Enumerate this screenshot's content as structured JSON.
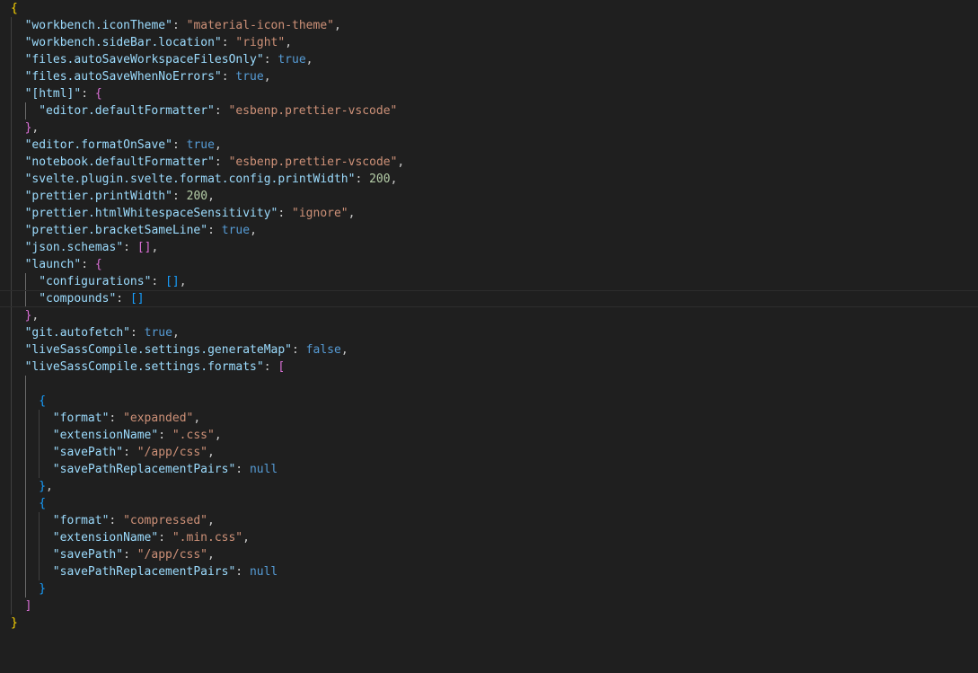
{
  "colors": {
    "background": "#1f1f1f",
    "key": "#9cdcfe",
    "string": "#ce9178",
    "number": "#b5cea8",
    "keyword": "#569cd6",
    "bracket_level_1": "#ffd700",
    "bracket_level_2": "#da70d6",
    "bracket_level_3": "#179fff"
  },
  "lines": [
    {
      "indent": 0,
      "tokens": [
        {
          "t": "{",
          "c": "b1"
        }
      ]
    },
    {
      "indent": 1,
      "tokens": [
        {
          "t": "\"workbench.iconTheme\"",
          "c": "key"
        },
        {
          "t": ": ",
          "c": "punc"
        },
        {
          "t": "\"material-icon-theme\"",
          "c": "str"
        },
        {
          "t": ",",
          "c": "punc"
        }
      ]
    },
    {
      "indent": 1,
      "tokens": [
        {
          "t": "\"workbench.sideBar.location\"",
          "c": "key"
        },
        {
          "t": ": ",
          "c": "punc"
        },
        {
          "t": "\"right\"",
          "c": "str"
        },
        {
          "t": ",",
          "c": "punc"
        }
      ]
    },
    {
      "indent": 1,
      "tokens": [
        {
          "t": "\"files.autoSaveWorkspaceFilesOnly\"",
          "c": "key"
        },
        {
          "t": ": ",
          "c": "punc"
        },
        {
          "t": "true",
          "c": "kw"
        },
        {
          "t": ",",
          "c": "punc"
        }
      ]
    },
    {
      "indent": 1,
      "tokens": [
        {
          "t": "\"files.autoSaveWhenNoErrors\"",
          "c": "key"
        },
        {
          "t": ": ",
          "c": "punc"
        },
        {
          "t": "true",
          "c": "kw"
        },
        {
          "t": ",",
          "c": "punc"
        }
      ]
    },
    {
      "indent": 1,
      "tokens": [
        {
          "t": "\"[html]\"",
          "c": "key"
        },
        {
          "t": ": ",
          "c": "punc"
        },
        {
          "t": "{",
          "c": "b2"
        }
      ]
    },
    {
      "indent": 2,
      "tokens": [
        {
          "t": "\"editor.defaultFormatter\"",
          "c": "key"
        },
        {
          "t": ": ",
          "c": "punc"
        },
        {
          "t": "\"esbenp.prettier-vscode\"",
          "c": "str"
        }
      ]
    },
    {
      "indent": 1,
      "tokens": [
        {
          "t": "}",
          "c": "b2"
        },
        {
          "t": ",",
          "c": "punc"
        }
      ]
    },
    {
      "indent": 1,
      "tokens": [
        {
          "t": "\"editor.formatOnSave\"",
          "c": "key"
        },
        {
          "t": ": ",
          "c": "punc"
        },
        {
          "t": "true",
          "c": "kw"
        },
        {
          "t": ",",
          "c": "punc"
        }
      ]
    },
    {
      "indent": 1,
      "tokens": [
        {
          "t": "\"notebook.defaultFormatter\"",
          "c": "key"
        },
        {
          "t": ": ",
          "c": "punc"
        },
        {
          "t": "\"esbenp.prettier-vscode\"",
          "c": "str"
        },
        {
          "t": ",",
          "c": "punc"
        }
      ]
    },
    {
      "indent": 1,
      "tokens": [
        {
          "t": "\"svelte.plugin.svelte.format.config.printWidth\"",
          "c": "key"
        },
        {
          "t": ": ",
          "c": "punc"
        },
        {
          "t": "200",
          "c": "num"
        },
        {
          "t": ",",
          "c": "punc"
        }
      ]
    },
    {
      "indent": 1,
      "tokens": [
        {
          "t": "\"prettier.printWidth\"",
          "c": "key"
        },
        {
          "t": ": ",
          "c": "punc"
        },
        {
          "t": "200",
          "c": "num"
        },
        {
          "t": ",",
          "c": "punc"
        }
      ]
    },
    {
      "indent": 1,
      "tokens": [
        {
          "t": "\"prettier.htmlWhitespaceSensitivity\"",
          "c": "key"
        },
        {
          "t": ": ",
          "c": "punc"
        },
        {
          "t": "\"ignore\"",
          "c": "str"
        },
        {
          "t": ",",
          "c": "punc"
        }
      ]
    },
    {
      "indent": 1,
      "tokens": [
        {
          "t": "\"prettier.bracketSameLine\"",
          "c": "key"
        },
        {
          "t": ": ",
          "c": "punc"
        },
        {
          "t": "true",
          "c": "kw"
        },
        {
          "t": ",",
          "c": "punc"
        }
      ]
    },
    {
      "indent": 1,
      "tokens": [
        {
          "t": "\"json.schemas\"",
          "c": "key"
        },
        {
          "t": ": ",
          "c": "punc"
        },
        {
          "t": "[]",
          "c": "b2"
        },
        {
          "t": ",",
          "c": "punc"
        }
      ]
    },
    {
      "indent": 1,
      "tokens": [
        {
          "t": "\"launch\"",
          "c": "key"
        },
        {
          "t": ": ",
          "c": "punc"
        },
        {
          "t": "{",
          "c": "b2"
        }
      ]
    },
    {
      "indent": 2,
      "tokens": [
        {
          "t": "\"configurations\"",
          "c": "key"
        },
        {
          "t": ": ",
          "c": "punc"
        },
        {
          "t": "[]",
          "c": "b3"
        },
        {
          "t": ",",
          "c": "punc"
        }
      ]
    },
    {
      "indent": 2,
      "current": true,
      "tokens": [
        {
          "t": "\"compounds\"",
          "c": "key"
        },
        {
          "t": ": ",
          "c": "punc"
        },
        {
          "t": "[]",
          "c": "b3"
        }
      ]
    },
    {
      "indent": 1,
      "tokens": [
        {
          "t": "}",
          "c": "b2"
        },
        {
          "t": ",",
          "c": "punc"
        }
      ]
    },
    {
      "indent": 1,
      "tokens": [
        {
          "t": "\"git.autofetch\"",
          "c": "key"
        },
        {
          "t": ": ",
          "c": "punc"
        },
        {
          "t": "true",
          "c": "kw"
        },
        {
          "t": ",",
          "c": "punc"
        }
      ]
    },
    {
      "indent": 1,
      "tokens": [
        {
          "t": "\"liveSassCompile.settings.generateMap\"",
          "c": "key"
        },
        {
          "t": ": ",
          "c": "punc"
        },
        {
          "t": "false",
          "c": "kw"
        },
        {
          "t": ",",
          "c": "punc"
        }
      ]
    },
    {
      "indent": 1,
      "tokens": [
        {
          "t": "\"liveSassCompile.settings.formats\"",
          "c": "key"
        },
        {
          "t": ": ",
          "c": "punc"
        },
        {
          "t": "[",
          "c": "b2"
        }
      ]
    },
    {
      "indent": 2,
      "tokens": []
    },
    {
      "indent": 2,
      "tokens": [
        {
          "t": "{",
          "c": "b3"
        }
      ]
    },
    {
      "indent": 3,
      "tokens": [
        {
          "t": "\"format\"",
          "c": "key"
        },
        {
          "t": ": ",
          "c": "punc"
        },
        {
          "t": "\"expanded\"",
          "c": "str"
        },
        {
          "t": ",",
          "c": "punc"
        }
      ]
    },
    {
      "indent": 3,
      "tokens": [
        {
          "t": "\"extensionName\"",
          "c": "key"
        },
        {
          "t": ": ",
          "c": "punc"
        },
        {
          "t": "\".css\"",
          "c": "str"
        },
        {
          "t": ",",
          "c": "punc"
        }
      ]
    },
    {
      "indent": 3,
      "tokens": [
        {
          "t": "\"savePath\"",
          "c": "key"
        },
        {
          "t": ": ",
          "c": "punc"
        },
        {
          "t": "\"/app/css\"",
          "c": "str"
        },
        {
          "t": ",",
          "c": "punc"
        }
      ]
    },
    {
      "indent": 3,
      "tokens": [
        {
          "t": "\"savePathReplacementPairs\"",
          "c": "key"
        },
        {
          "t": ": ",
          "c": "punc"
        },
        {
          "t": "null",
          "c": "kw"
        }
      ]
    },
    {
      "indent": 2,
      "tokens": [
        {
          "t": "}",
          "c": "b3"
        },
        {
          "t": ",",
          "c": "punc"
        }
      ]
    },
    {
      "indent": 2,
      "tokens": [
        {
          "t": "{",
          "c": "b3"
        }
      ]
    },
    {
      "indent": 3,
      "tokens": [
        {
          "t": "\"format\"",
          "c": "key"
        },
        {
          "t": ": ",
          "c": "punc"
        },
        {
          "t": "\"compressed\"",
          "c": "str"
        },
        {
          "t": ",",
          "c": "punc"
        }
      ]
    },
    {
      "indent": 3,
      "tokens": [
        {
          "t": "\"extensionName\"",
          "c": "key"
        },
        {
          "t": ": ",
          "c": "punc"
        },
        {
          "t": "\".min.css\"",
          "c": "str"
        },
        {
          "t": ",",
          "c": "punc"
        }
      ]
    },
    {
      "indent": 3,
      "tokens": [
        {
          "t": "\"savePath\"",
          "c": "key"
        },
        {
          "t": ": ",
          "c": "punc"
        },
        {
          "t": "\"/app/css\"",
          "c": "str"
        },
        {
          "t": ",",
          "c": "punc"
        }
      ]
    },
    {
      "indent": 3,
      "tokens": [
        {
          "t": "\"savePathReplacementPairs\"",
          "c": "key"
        },
        {
          "t": ": ",
          "c": "punc"
        },
        {
          "t": "null",
          "c": "kw"
        }
      ]
    },
    {
      "indent": 2,
      "tokens": [
        {
          "t": "}",
          "c": "b3"
        }
      ]
    },
    {
      "indent": 1,
      "tokens": [
        {
          "t": "]",
          "c": "b2"
        }
      ]
    },
    {
      "indent": 0,
      "tokens": [
        {
          "t": "}",
          "c": "b1"
        }
      ]
    }
  ]
}
